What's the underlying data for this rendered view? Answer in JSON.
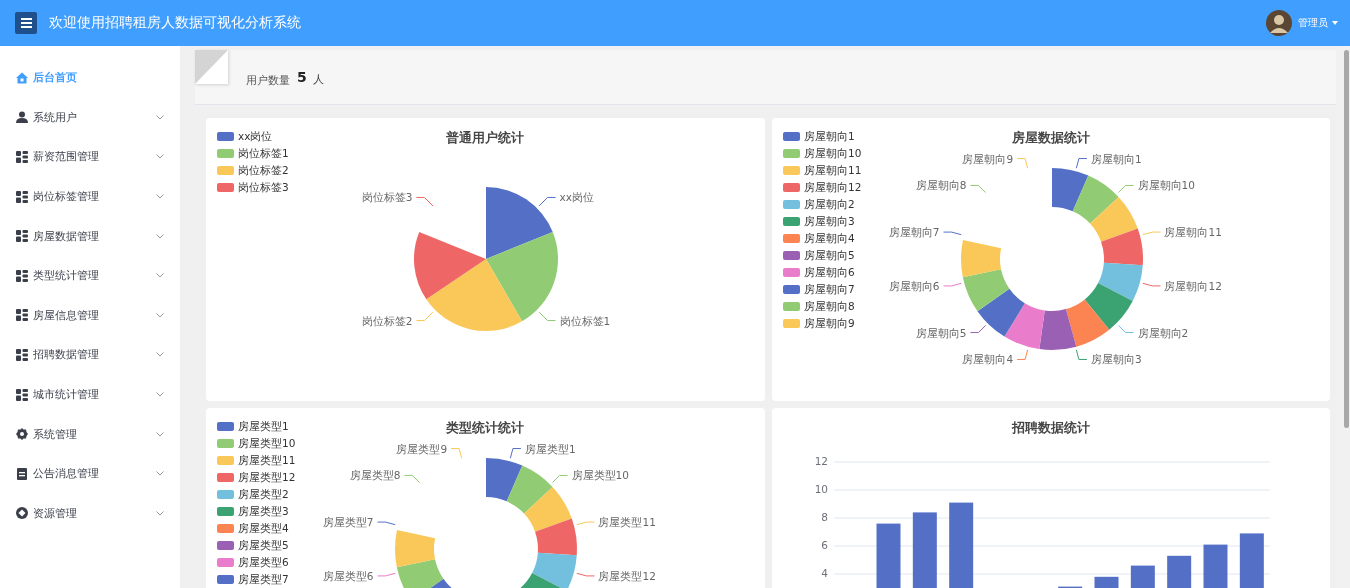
{
  "header": {
    "title": "欢迎使用招聘租房人数据可视化分析系统",
    "user": "管理员"
  },
  "sidebar": {
    "items": [
      {
        "label": "后台首页",
        "selected": true,
        "has_submenu": false
      },
      {
        "label": "系统用户",
        "selected": false,
        "has_submenu": true
      },
      {
        "label": "薪资范围管理",
        "selected": false,
        "has_submenu": true
      },
      {
        "label": "岗位标签管理",
        "selected": false,
        "has_submenu": true
      },
      {
        "label": "房屋数据管理",
        "selected": false,
        "has_submenu": true
      },
      {
        "label": "类型统计管理",
        "selected": false,
        "has_submenu": true
      },
      {
        "label": "房屋信息管理",
        "selected": false,
        "has_submenu": true
      },
      {
        "label": "招聘数据管理",
        "selected": false,
        "has_submenu": true
      },
      {
        "label": "城市统计管理",
        "selected": false,
        "has_submenu": true
      },
      {
        "label": "系统管理",
        "selected": false,
        "has_submenu": true
      },
      {
        "label": "公告消息管理",
        "selected": false,
        "has_submenu": true
      },
      {
        "label": "资源管理",
        "selected": false,
        "has_submenu": true
      }
    ]
  },
  "stats": {
    "label": "用户数量",
    "value": "5",
    "unit": "人"
  },
  "cards": [
    {
      "kind": "pie",
      "title": "普通用户统计",
      "items": [
        {
          "legend": "xx岗位",
          "label": "xx岗位",
          "color": "#5470c6"
        },
        {
          "legend": "岗位标签1",
          "label": "岗位标签1",
          "color": "#91cc75"
        },
        {
          "legend": "岗位标签2",
          "label": "岗位标签2",
          "color": "#fac858"
        },
        {
          "legend": "岗位标签3",
          "label": "岗位标签3",
          "color": "#ee6666"
        }
      ]
    },
    {
      "kind": "donut",
      "title": "房屋数据统计",
      "items": [
        {
          "legend": "房屋朝向1",
          "label": "房屋朝向1",
          "color": "#5470c6"
        },
        {
          "legend": "房屋朝向10",
          "label": "房屋朝向10",
          "color": "#91cc75"
        },
        {
          "legend": "房屋朝向11",
          "label": "房屋朝向11",
          "color": "#fac858"
        },
        {
          "legend": "房屋朝向12",
          "label": "房屋朝向12",
          "color": "#ee6666"
        },
        {
          "legend": "房屋朝向2",
          "label": "房屋朝向2",
          "color": "#73c0de"
        },
        {
          "legend": "房屋朝向3",
          "label": "房屋朝向3",
          "color": "#3ba272"
        },
        {
          "legend": "房屋朝向4",
          "label": "房屋朝向4",
          "color": "#fc8452"
        },
        {
          "legend": "房屋朝向5",
          "label": "房屋朝向5",
          "color": "#9a60b4"
        },
        {
          "legend": "房屋朝向6",
          "label": "房屋朝向6",
          "color": "#ea7ccc"
        },
        {
          "legend": "房屋朝向7",
          "label": "房屋朝向7",
          "color": "#5470c6"
        },
        {
          "legend": "房屋朝向8",
          "label": "房屋朝向8",
          "color": "#91cc75"
        },
        {
          "legend": "房屋朝向9",
          "label": "房屋朝向9",
          "color": "#fac858"
        }
      ]
    },
    {
      "kind": "donut",
      "title": "类型统计统计",
      "items": [
        {
          "legend": "房屋类型1",
          "label": "房屋类型1",
          "color": "#5470c6"
        },
        {
          "legend": "房屋类型10",
          "label": "房屋类型10",
          "color": "#91cc75"
        },
        {
          "legend": "房屋类型11",
          "label": "房屋类型11",
          "color": "#fac858"
        },
        {
          "legend": "房屋类型12",
          "label": "房屋类型12",
          "color": "#ee6666"
        },
        {
          "legend": "房屋类型2",
          "color": "#73c0de"
        },
        {
          "legend": "房屋类型3",
          "color": "#3ba272"
        },
        {
          "legend": "房屋类型4",
          "color": "#fc8452"
        },
        {
          "legend": "房屋类型5",
          "color": "#9a60b4"
        },
        {
          "legend": "房屋类型6",
          "label": "房屋类型6",
          "color": "#ea7ccc"
        },
        {
          "legend": "房屋类型7",
          "label": "房屋类型7",
          "color": "#5470c6"
        },
        {
          "label": "房屋类型8",
          "color": "#91cc75"
        },
        {
          "label": "房屋类型9",
          "color": "#fac858"
        }
      ]
    },
    {
      "kind": "bar",
      "chart_data": {
        "type": "bar",
        "title": "招聘数据统计",
        "values": [
          null,
          7.6,
          8.4,
          9.1,
          null,
          null,
          3.1,
          3.8,
          4.6,
          5.3,
          6.1,
          6.9
        ],
        "ylim": [
          0,
          12
        ],
        "yticks": [
          4,
          6,
          8,
          10,
          12
        ],
        "grid": true
      }
    }
  ]
}
